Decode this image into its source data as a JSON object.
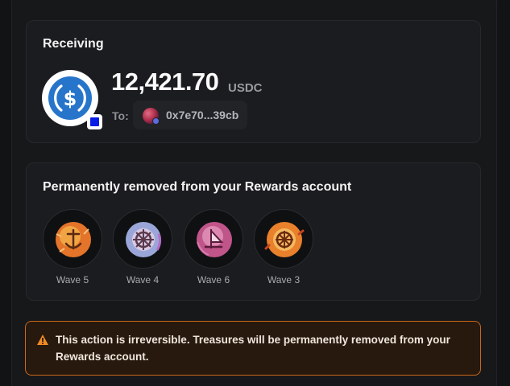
{
  "receiving": {
    "title": "Receiving",
    "token_icon": "usdc-icon",
    "chain_badge_color": "#0a1de6",
    "amount": "12,421.70",
    "unit": "USDC",
    "to_label": "To:",
    "address": "0x7e70...39cb"
  },
  "removed": {
    "title": "Permanently removed from your Rewards account",
    "treasures": [
      {
        "label": "Wave 5",
        "icon": "anchor-treasure-icon",
        "color": "#e3742a"
      },
      {
        "label": "Wave 4",
        "icon": "ship-wheel-treasure-icon",
        "color": "#9aa6d8"
      },
      {
        "label": "Wave 6",
        "icon": "sail-treasure-icon",
        "color": "#c0558a"
      },
      {
        "label": "Wave 3",
        "icon": "compass-treasure-icon",
        "color": "#e8802c"
      }
    ]
  },
  "warning": {
    "icon": "warning-triangle-icon",
    "text": "This action is irreversible. Treasures will be permanently removed from your Rewards account.",
    "accent": "#c9681a"
  }
}
